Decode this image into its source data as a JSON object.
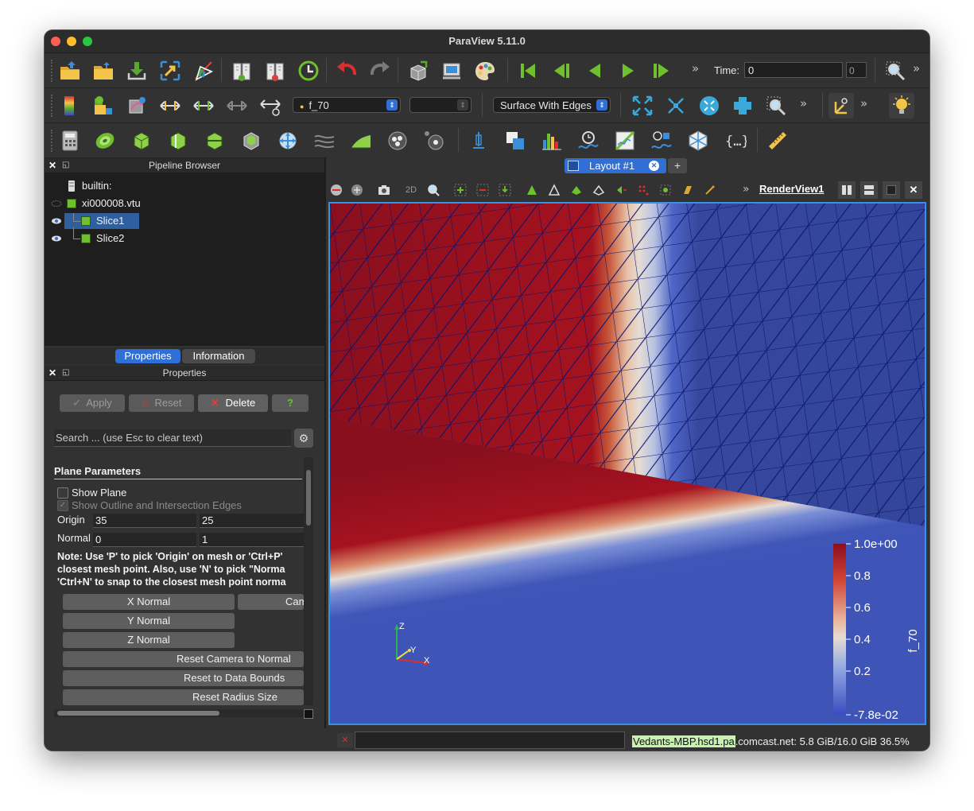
{
  "window": {
    "title": "ParaView 5.11.0"
  },
  "toolbar": {
    "array_combo": "f_70",
    "component_combo": "",
    "representation_combo": "Surface With Edges",
    "time_label": "Time:",
    "time_value": "0",
    "time_index": "0",
    "more": "»"
  },
  "pipeline": {
    "title": "Pipeline Browser",
    "items": [
      {
        "label": "builtin:"
      },
      {
        "label": "xi000008.vtu"
      },
      {
        "label": "Slice1"
      },
      {
        "label": "Slice2"
      }
    ]
  },
  "panel_tabs": {
    "properties": "Properties",
    "information": "Information"
  },
  "properties": {
    "title": "Properties",
    "apply": "Apply",
    "reset": "Reset",
    "delete": "Delete",
    "help": "?",
    "search_placeholder": "Search ... (use Esc to clear text)",
    "section": "Plane Parameters",
    "show_plane": "Show Plane",
    "show_outline": "Show Outline and Intersection Edges",
    "origin_label": "Origin",
    "origin_x": "35",
    "origin_y": "25",
    "normal_label": "Normal",
    "normal_x": "0",
    "normal_y": "1",
    "note_line1": "Note: Use 'P' to pick 'Origin' on mesh or 'Ctrl+P'",
    "note_line2": "closest mesh point. Also, use 'N' to pick \"Norma",
    "note_line3": "'Ctrl+N' to snap to the closest mesh point norma",
    "x_normal": "X Normal",
    "camera_normal": "Cam",
    "y_normal": "Y Normal",
    "z_normal": "Z Normal",
    "reset_camera": "Reset Camera to Normal",
    "reset_bounds": "Reset to Data Bounds",
    "reset_radius": "Reset Radius Size"
  },
  "layout": {
    "tab": "Layout #1",
    "close": "✕",
    "add": "+"
  },
  "view": {
    "label": "RenderView1",
    "mode_2d": "2D",
    "axes": {
      "z": "Z",
      "y": "Y",
      "x": "X"
    },
    "colorbar": {
      "title": "f_70",
      "ticks": [
        "1.0e+00",
        "0.8",
        "0.6",
        "0.4",
        "0.2",
        "-7.8e-02"
      ],
      "colors": {
        "high": "#8a0f1e",
        "mid": "#e8d7cf",
        "low": "#3a4cc0"
      }
    }
  },
  "status": {
    "memory": "Vedants-MBP.hsd1.pa.comcast.net: 5.8 GiB/16.0 GiB 36.5%",
    "memory_highlight_color": "#c8f2b0"
  }
}
